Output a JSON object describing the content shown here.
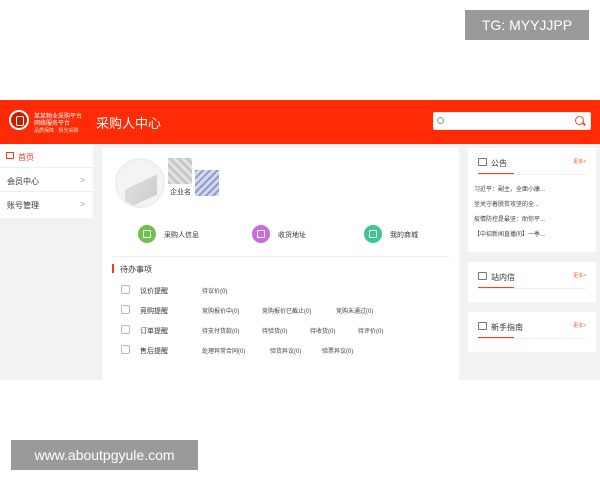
{
  "watermarks": {
    "top_right": "TG: MYYJJPP",
    "bottom_left": "www.aboutpgyule.com"
  },
  "header": {
    "logo_line1": "某某物业采购平台",
    "logo_line2": "网络服务平台",
    "logo_line3": "品质保障 · 阳光采购",
    "title": "采购人中心",
    "search_placeholder": ""
  },
  "sidebar": {
    "items": [
      {
        "label": "首页"
      },
      {
        "label": "会员中心"
      },
      {
        "label": "账号管理"
      }
    ]
  },
  "profile": {
    "company_name": "企业名"
  },
  "quick_links": [
    {
      "label": "采购人信息",
      "color": "#6cc24a"
    },
    {
      "label": "收货地址",
      "color": "#cc6bde"
    },
    {
      "label": "我的商城",
      "color": "#3fc58e"
    }
  ],
  "todo": {
    "title": "待办事项",
    "rows": [
      {
        "label": "议价提醒",
        "items": [
          "待议价(0)"
        ]
      },
      {
        "label": "竞购提醒",
        "items": [
          "竞购报价中(0)",
          "竞购报价已截止(0)",
          "竞购未通过(0)"
        ]
      },
      {
        "label": "订单提醒",
        "items": [
          "待支付货款(0)",
          "待验货(0)",
          "待收货(0)",
          "待评价(0)"
        ]
      },
      {
        "label": "售后提醒",
        "items": [
          "处理异常合同(0)",
          "验货异议(0)",
          "验票异议(0)"
        ]
      }
    ]
  },
  "announcements": {
    "title": "公告",
    "more": "更多>",
    "items": [
      "习近平：副主，全面小康...",
      "坐关守着脱贫攻坚的全...",
      "疫情防控是最坚：助你平...",
      "【中招新闻直播间】一季..."
    ]
  },
  "station_messages": {
    "title": "站内信",
    "more": "更多>"
  },
  "new_user_guide": {
    "title": "新手指南",
    "more": "更多>"
  },
  "colors": {
    "brand_red": "#ff2b06",
    "accent_red": "#ff3b16",
    "page_bg": "#f2f2f2"
  }
}
